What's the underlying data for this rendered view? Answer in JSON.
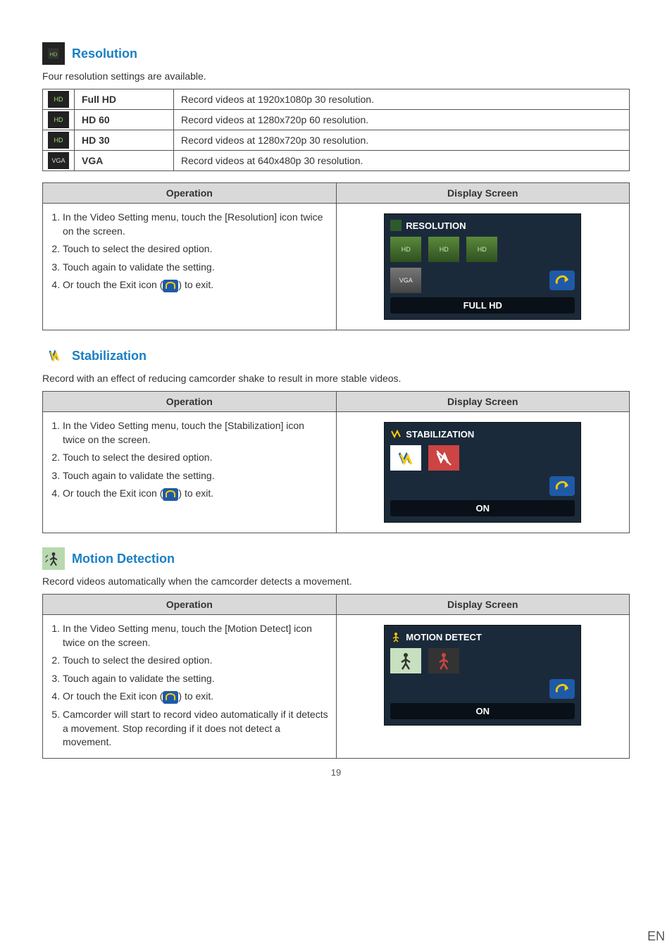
{
  "resolution": {
    "heading": "Resolution",
    "intro": "Four resolution settings are available.",
    "rows": [
      {
        "label": "Full HD",
        "desc": "Record videos at 1920x1080p 30 resolution.",
        "icon": "HD"
      },
      {
        "label": "HD 60",
        "desc": "Record videos at 1280x720p 60 resolution.",
        "icon": "HD"
      },
      {
        "label": "HD 30",
        "desc": "Record videos at 1280x720p 30 resolution.",
        "icon": "HD"
      },
      {
        "label": "VGA",
        "desc": "Record videos at 640x480p 30 resolution.",
        "icon": "VGA"
      }
    ],
    "op_header": "Operation",
    "ds_header": "Display Screen",
    "steps": [
      "In the Video Setting menu, touch the [Resolution] icon twice on the screen.",
      "Touch to select the desired option.",
      "Touch again to validate the setting.",
      "Or touch the Exit icon ( ) to exit."
    ],
    "ds_title": "RESOLUTION",
    "ds_status": "FULL HD",
    "ds_opts": [
      "HD",
      "HD",
      "HD"
    ],
    "ds_vga": "VGA"
  },
  "stabilization": {
    "heading": "Stabilization",
    "intro": "Record with an effect of reducing camcorder shake to result in more stable videos.",
    "op_header": "Operation",
    "ds_header": "Display Screen",
    "steps": [
      "In the Video Setting menu, touch the [Stabilization] icon twice on the screen.",
      "Touch to select the desired option.",
      "Touch again to validate the setting.",
      "Or touch the Exit icon ( ) to exit."
    ],
    "ds_title": "STABILIZATION",
    "ds_status": "ON"
  },
  "motion": {
    "heading": "Motion Detection",
    "intro": "Record videos automatically when the camcorder detects a movement.",
    "op_header": "Operation",
    "ds_header": "Display Screen",
    "steps": [
      "In the Video Setting menu, touch the [Motion Detect] icon twice on the screen.",
      "Touch to select the desired option.",
      "Touch again to validate the setting.",
      "Or touch the Exit icon ( ) to exit.",
      "Camcorder will start to record video automatically if it detects a movement. Stop recording if it does not detect a movement."
    ],
    "ds_title": "MOTION DETECT",
    "ds_status": "ON"
  },
  "page_number": "19",
  "lang": "EN"
}
